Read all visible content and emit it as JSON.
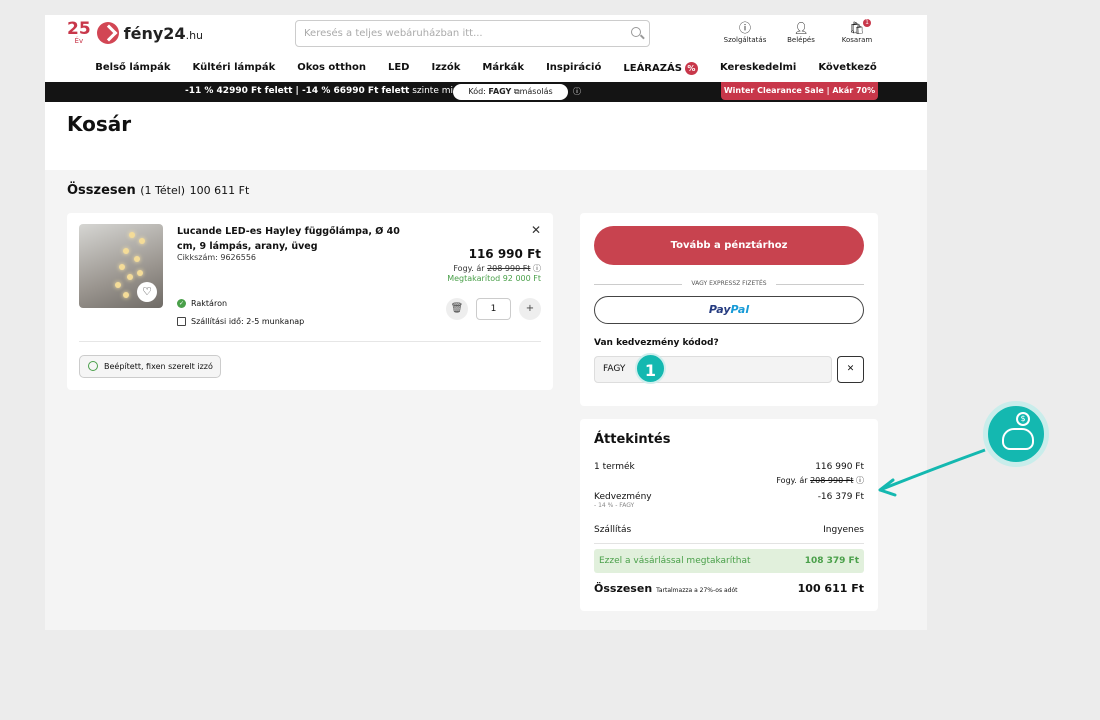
{
  "header": {
    "logo_num": "25",
    "logo_ev": "Év",
    "brand": "fény24",
    "brand_tld": ".hu",
    "search_placeholder": "Keresés a teljes webáruházban itt...",
    "service_label": "Szolgáltatás",
    "login_label": "Belépés",
    "cart_label": "Kosaram",
    "cart_count": "1"
  },
  "nav": [
    "Belső lámpák",
    "Kültéri lámpák",
    "Okos otthon",
    "LED",
    "Izzók",
    "Márkák",
    "Inspiráció",
    "LEÁRAZÁS",
    "Kereskedelmi",
    "Következő"
  ],
  "nav_badge": "%",
  "promo": {
    "text_bold": "-11 % 42990 Ft felett | -14 % 66990 Ft felett",
    "text_rest": " szinte mindenre",
    "code_label": "Kód:",
    "code": "FAGY",
    "copy_label": "másolás",
    "sale": "Winter Clearance Sale | Akár 70%"
  },
  "page_title": "Kosár",
  "total": {
    "label": "Összesen",
    "count": "(1 Tétel)",
    "amount": "100 611 Ft"
  },
  "product": {
    "name": "Lucande LED-es Hayley függőlámpa, Ø 40 cm, 9 lámpás, arany, üveg",
    "sku": "Cikkszám: 9626556",
    "price": "116 990 Ft",
    "ref_label": "Fogy. ár",
    "ref_price": "208 990 Ft",
    "saving": "Megtakarítod 92 000 Ft",
    "stock": "Raktáron",
    "shipping": "Szállítási idő: 2-5 munkanap",
    "qty": "1",
    "chip": "Beépített, fixen szerelt izzó"
  },
  "checkout": {
    "button": "Tovább a pénztárhoz",
    "or": "VAGY EXPRESSZ FIZETÉS",
    "paypal_a": "Pay",
    "paypal_b": "Pal",
    "discount_q": "Van kedvezmény kódod?",
    "code_value": "FAGY",
    "step": "1"
  },
  "overview": {
    "title": "Áttekintés",
    "items_label": "1 termék",
    "items_price": "116 990 Ft",
    "items_ref_label": "Fogy. ár",
    "items_ref": "208 990 Ft",
    "discount_label": "Kedvezmény",
    "discount_sub": "- 14 % - FAGY",
    "discount_value": "-16 379 Ft",
    "shipping_label": "Szállítás",
    "shipping_value": "Ingyenes",
    "saving_label": "Ezzel a vásárlással megtakaríthat",
    "saving_value": "108 379 Ft",
    "total_label": "Összesen",
    "total_note": "Tartalmazza a 27%-os adót",
    "total_value": "100 611 Ft"
  },
  "colors": {
    "brand": "#c8374a",
    "accent": "#14b8b0",
    "green": "#4aa04a"
  }
}
